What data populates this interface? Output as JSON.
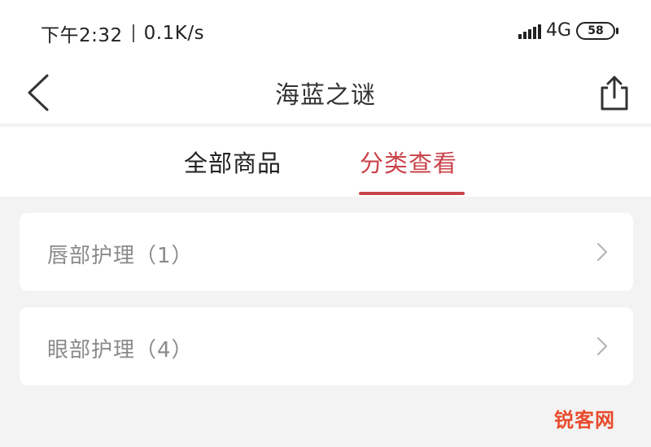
{
  "status_bar": {
    "time": "下午2:32",
    "network_speed": "0.1K/s",
    "network_type": "4G",
    "battery": "58"
  },
  "nav": {
    "back_icon": "chevron-left-icon",
    "title": "海蓝之谜",
    "share_icon": "share-icon"
  },
  "tabs": [
    {
      "label": "全部商品",
      "active": false
    },
    {
      "label": "分类查看",
      "active": true
    }
  ],
  "categories": [
    {
      "label": "唇部护理（1）"
    },
    {
      "label": "眼部护理（4）"
    }
  ],
  "watermark": "锐客网",
  "colors": {
    "accent": "#c9434a",
    "background": "#f3f3f3",
    "card": "#ffffff",
    "secondary_text": "#8a8a8a"
  }
}
